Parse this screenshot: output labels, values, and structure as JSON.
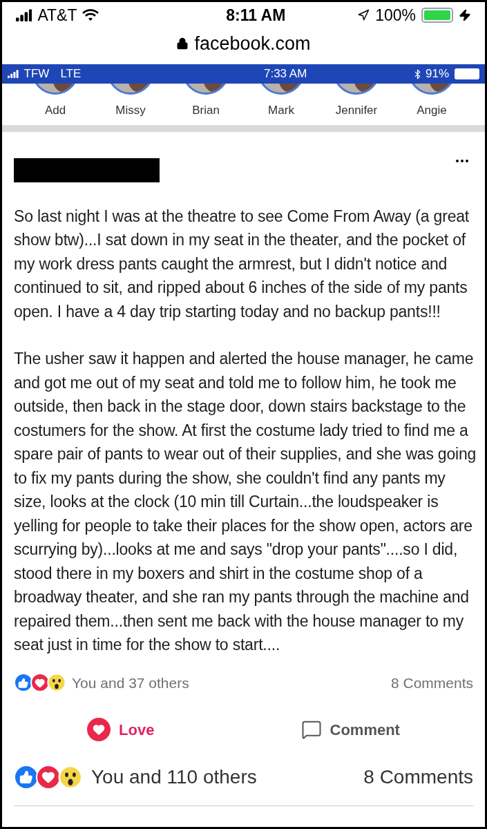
{
  "phone_status": {
    "carrier": "AT&T",
    "time": "8:11 AM",
    "battery": "100%",
    "charging": true
  },
  "address_bar": {
    "url": "facebook.com"
  },
  "screenshot": {
    "status_bar": {
      "carrier": "TFW",
      "network": "LTE",
      "time": "7:33 AM",
      "battery": "91%"
    },
    "stories": [
      {
        "name": "Add"
      },
      {
        "name": "Missy"
      },
      {
        "name": "Brian"
      },
      {
        "name": "Mark"
      },
      {
        "name": "Jennifer"
      },
      {
        "name": "Angie"
      }
    ],
    "post": {
      "paragraphs": [
        "So last night I was at the theatre to see Come From Away (a great show btw)...I sat down in my seat in the theater, and the pocket of my work dress pants caught the armrest, but I didn't notice and continued to sit, and ripped about 6 inches of the side of my pants open. I have a 4 day trip starting today and no backup pants!!!",
        "The usher saw it happen and alerted the house manager, he came and got me out of my seat and told me to follow him, he took me outside, then back in the stage door, down stairs backstage to the costumers for the show. At first the costume lady tried to find me a spare pair of pants to wear out of their supplies, and she was going to fix my pants during the show, she couldn't find any pants my size, looks at the clock (10 min till Curtain...the loudspeaker is yelling for people to take their places for the show open, actors are scurrying by)...looks at me and says \"drop your pants\"....so I did, stood there in my boxers and shirt in the costume shop of a broadway theater, and she ran my pants through the machine and repaired them...then sent me back with the house manager to my seat just in time for the show to start...."
      ],
      "reactions": {
        "summary": "You and 37 others",
        "comments": "8 Comments"
      },
      "actions": [
        {
          "kind": "love",
          "label": "Love",
          "selected": true
        },
        {
          "kind": "comment",
          "label": "Comment",
          "selected": false
        }
      ]
    }
  },
  "footer": {
    "summary": "You and 110 others",
    "comments": "8 Comments"
  }
}
